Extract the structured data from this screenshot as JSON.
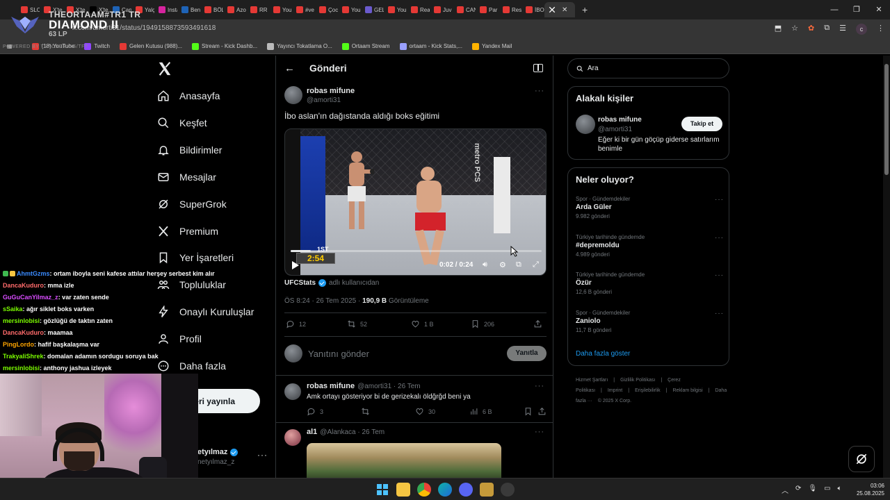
{
  "browser": {
    "tabs": [
      {
        "label": "SLO",
        "color": "#e53935"
      },
      {
        "label": "X'te",
        "color": "#e53935"
      },
      {
        "label": "X'te",
        "color": "#e53935"
      },
      {
        "label": "X'te",
        "color": "#000000"
      },
      {
        "label": "Can",
        "color": "#1e63b6"
      },
      {
        "label": "Yalç",
        "color": "#e53935"
      },
      {
        "label": "Insta",
        "color": "#d6249f"
      },
      {
        "label": "Beni",
        "color": "#1e63b6"
      },
      {
        "label": "BÖL",
        "color": "#e53935"
      },
      {
        "label": "Azo",
        "color": "#e53935"
      },
      {
        "label": "RR",
        "color": "#e53935"
      },
      {
        "label": "You",
        "color": "#e53935"
      },
      {
        "label": "#ve",
        "color": "#e53935"
      },
      {
        "label": "Çoc",
        "color": "#e53935"
      },
      {
        "label": "You",
        "color": "#e53935"
      },
      {
        "label": "GEL",
        "color": "#6a5acd"
      },
      {
        "label": "You",
        "color": "#e53935"
      },
      {
        "label": "Rea",
        "color": "#e53935"
      },
      {
        "label": "Juv",
        "color": "#e53935"
      },
      {
        "label": "CAN",
        "color": "#e53935"
      },
      {
        "label": "Par",
        "color": "#e53935"
      },
      {
        "label": "Res",
        "color": "#e53935"
      },
      {
        "label": "İBO",
        "color": "#e53935"
      }
    ],
    "active_tab_icon": "x-logo-icon",
    "url": "x.com/amorti31/status/1949158873593491618",
    "bookmarks": [
      {
        "label": "(18) YouTube",
        "color": "#e53935"
      },
      {
        "label": "Twitch",
        "color": "#9146ff"
      },
      {
        "label": "Gelen Kutusu (988)...",
        "color": "#e53935"
      },
      {
        "label": "Stream - Kick Dashb...",
        "color": "#53fc18"
      },
      {
        "label": "Yayıncı Tokatlama O...",
        "color": "#bbbbbb"
      },
      {
        "label": "Ortaam Stream",
        "color": "#53fc18"
      },
      {
        "label": "ortaam - Kick Stats,...",
        "color": "#9aa0ff"
      },
      {
        "label": "Yandex Mail",
        "color": "#ffb300"
      }
    ],
    "profile_initial": "c"
  },
  "rank_overlay": {
    "title": "THEORTAAM#TR1 TR",
    "tier": "DIAMOND II",
    "lp": "63 LP",
    "powered": "POWERED BY TRACKER.GG/TFT"
  },
  "nav": {
    "items": [
      {
        "label": "Anasayfa",
        "icon": "home-icon"
      },
      {
        "label": "Keşfet",
        "icon": "search-icon"
      },
      {
        "label": "Bildirimler",
        "icon": "bell-icon"
      },
      {
        "label": "Mesajlar",
        "icon": "mail-icon"
      },
      {
        "label": "SuperGrok",
        "icon": "grok-icon"
      },
      {
        "label": "Premium",
        "icon": "x-icon"
      },
      {
        "label": "Yer İşaretleri",
        "icon": "bookmark-icon"
      },
      {
        "label": "Topluluklar",
        "icon": "people-icon"
      },
      {
        "label": "Onaylı Kuruluşlar",
        "icon": "lightning-icon"
      },
      {
        "label": "Profil",
        "icon": "user-icon"
      },
      {
        "label": "Daha fazla",
        "icon": "more-circle-icon"
      }
    ],
    "post_button": "eri yayınla",
    "account_name": "etyılmaz",
    "account_handle": "netyılmaz_z"
  },
  "chat": [
    {
      "user": "AhmtGzms",
      "color": "#3a8bff",
      "text": ": ortam iboyla seni kafese attılar herşey serbest kim alır",
      "badge": true
    },
    {
      "user": "DancaKuduro",
      "color": "#ff6b6b",
      "text": ": mma izle"
    },
    {
      "user": "GuGuCanYilmaz_z",
      "color": "#d94cff",
      "text": ": var zaten sende"
    },
    {
      "user": "sSaika",
      "color": "#7cfc00",
      "text": ": ağır siklet boks varken"
    },
    {
      "user": "mersinlobisi",
      "color": "#7cfc00",
      "text": ": gözlüğü de taktın zaten"
    },
    {
      "user": "DancaKuduro",
      "color": "#ff6b6b",
      "text": ": maamaa"
    },
    {
      "user": "PingLordo",
      "color": "#ffa500",
      "text": ": hafif başkalaşma var"
    },
    {
      "user": "TrakyaliShrek",
      "color": "#7cfc00",
      "text": ": domalan adamın sordugu soruya bak"
    },
    {
      "user": "mersinlobisi",
      "color": "#7cfc00",
      "text": ": anthony jashua izleyek"
    }
  ],
  "post": {
    "header_title": "Gönderi",
    "author_name": "robas mifune",
    "author_handle": "@amorti31",
    "text": "İbo aslan'ın dağıstanda aldığı boks eğitimi",
    "video": {
      "round": "1ST",
      "clock": "2:54",
      "time": "0:02 / 0:24",
      "progress": 0.08,
      "sponsor": "metro PCS"
    },
    "source_name": "UFCStats",
    "source_suffix": "adlı kullanıcıdan",
    "timestamp": "ÖS 8:24 · 26 Tem 2025 · ",
    "views": "190,9 B",
    "views_label": "Görüntüleme",
    "stats": {
      "replies": "12",
      "reposts": "52",
      "likes": "1 B",
      "bookmarks": "206"
    },
    "reply_placeholder": "Yanıtını gönder",
    "reply_button": "Yanıtla"
  },
  "replies": [
    {
      "name": "robas mifune",
      "meta": "@amorti31 · 26 Tem",
      "text": "Amk ortayı gösteriyor bi de gerizekalı öldğrğd beni ya",
      "replies": "3",
      "likes": "30",
      "views": "6 B"
    },
    {
      "name": "al1",
      "meta": "@Alankaca · 26 Tem"
    }
  ],
  "right": {
    "search_placeholder": "Ara",
    "relevant_title": "Alakalı kişiler",
    "relevant": {
      "name": "robas mifune",
      "handle": "@amorti31",
      "bio": "Eğer ki bir gün göçüp giderse satırlarım benimle",
      "follow": "Takip et"
    },
    "trends_title": "Neler oluyor?",
    "trends": [
      {
        "category": "Spor · Gündemdekiler",
        "name": "Arda Güler",
        "count": "9.982 gönderi"
      },
      {
        "category": "Türkiye tarihinde gündemde",
        "name": "#depremoldu",
        "count": "4.989 gönderi"
      },
      {
        "category": "Türkiye tarihinde gündemde",
        "name": "Özür",
        "count": "12,6 B gönderi"
      },
      {
        "category": "Spor · Gündemdekiler",
        "name": "Zaniolo",
        "count": "11,7 B gönderi"
      }
    ],
    "show_more": "Daha fazla göster",
    "footer": [
      "Hizmet Şartları",
      "|",
      "Gizlilik Politikası",
      "|",
      "Çerez Politikası",
      "|",
      "Imprint",
      "|",
      "Erişilebilirlik",
      "|",
      "Reklam bilgisi",
      "|",
      "Daha fazla ···",
      "© 2025 X Corp."
    ]
  },
  "taskbar": {
    "time": "03:06",
    "date": "25.08.2025"
  }
}
